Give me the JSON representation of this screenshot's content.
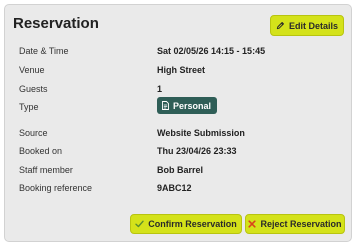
{
  "reservation": {
    "title": "Reservation",
    "edit_label": "Edit Details",
    "fields": [
      {
        "label": "Date & Time",
        "value": "Sat 02/05/26 14:15 - 15:45"
      },
      {
        "label": "Venue",
        "value": "High Street"
      },
      {
        "label": "Guests",
        "value": "1"
      },
      {
        "label": "Type",
        "value": "Personal"
      },
      {
        "label": "Source",
        "value": "Website Submission"
      },
      {
        "label": "Booked on",
        "value": "Thu 23/04/26 23:33"
      },
      {
        "label": "Staff member",
        "value": "Bob Barrel"
      },
      {
        "label": "Booking reference",
        "value": "9ABC12"
      }
    ],
    "confirm_label": "Confirm Reservation",
    "reject_label": "Reject Reservation"
  },
  "colors": {
    "accent": "#d4e21a",
    "badge": "#2f5e57",
    "card_bg": "#eaeaea",
    "reject_icon": "#d9441c",
    "confirm_icon": "#5a8f2e"
  },
  "icons": {
    "edit": "pencil-icon",
    "type_badge": "document-icon",
    "confirm": "check-icon",
    "reject": "x-icon"
  }
}
